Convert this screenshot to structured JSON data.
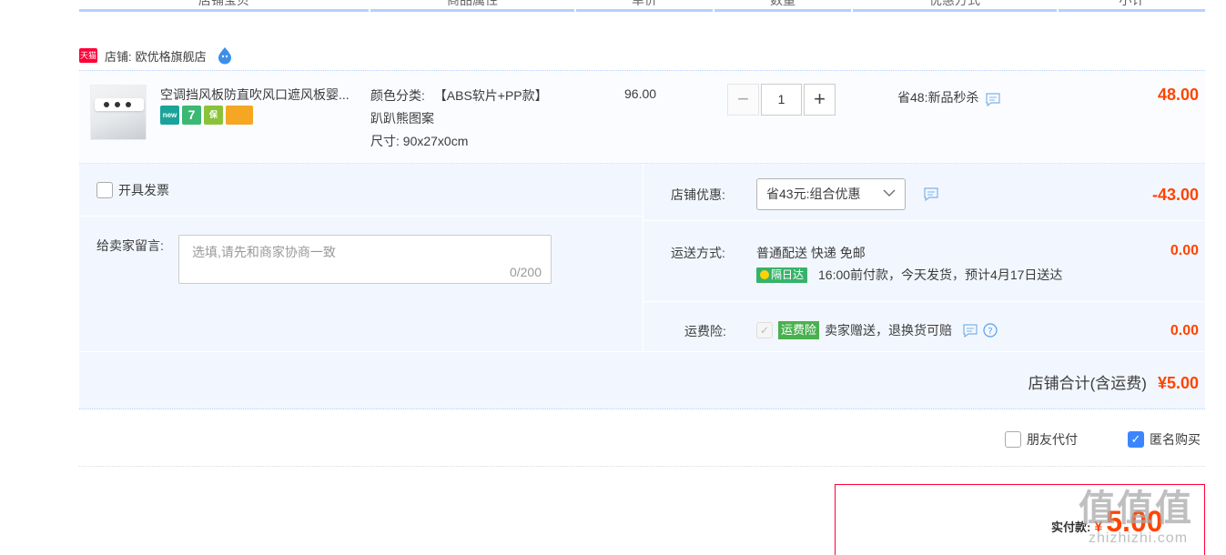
{
  "table_header": {
    "columns": [
      "店铺宝贝",
      "商品属性",
      "单价",
      "数量",
      "优惠方式",
      "小计"
    ]
  },
  "shop": {
    "tmall_badge": "天猫",
    "label": "店铺:",
    "name": "欧优格旗舰店"
  },
  "item": {
    "title": "空调挡风板防直吹风口遮风板婴...",
    "badges": [
      {
        "icon": "new-icon",
        "text": "new",
        "color": "#1aa39a"
      },
      {
        "icon": "seven-day-icon",
        "text": "7",
        "color": "#3bb873"
      },
      {
        "icon": "guarantee-icon",
        "text": "保",
        "color": "#8ac33a"
      },
      {
        "icon": "card-icon",
        "text": "",
        "color": "#f5a623"
      }
    ],
    "prop_color_label": "颜色分类:",
    "prop_color_value": "【ABS软片+PP款】",
    "prop_color_value2": "趴趴熊图案",
    "prop_size": "尺寸: 90x27x0cm",
    "unit_price": "96.00",
    "quantity": "1",
    "minus": "−",
    "plus": "+",
    "promotion": "省48:新品秒杀",
    "subtotal": "48.00"
  },
  "invoice": {
    "label": "开具发票"
  },
  "message": {
    "label": "给卖家留言:",
    "placeholder": "选填,请先和商家协商一致",
    "count": "0/200"
  },
  "shop_discount": {
    "label": "店铺优惠:",
    "selected": "省43元:组合优惠",
    "amount": "-43.00"
  },
  "shipping": {
    "label": "运送方式:",
    "method": "普通配送 快递 免邮",
    "next_day_tag": "隔日达",
    "delivery_note": "16:00前付款，今天发货，预计4月17日送达",
    "amount": "0.00"
  },
  "insurance": {
    "label": "运费险:",
    "tag": "运费险",
    "text": "卖家赠送，退换货可赔",
    "amount": "0.00"
  },
  "shop_total": {
    "label": "店铺合计(含运费)",
    "value": "¥5.00"
  },
  "options": {
    "friend_pay": "朋友代付",
    "anonymous": "匿名购买"
  },
  "payment": {
    "label": "实付款:",
    "currency": "¥",
    "value": "5.00"
  },
  "watermark": {
    "main": "值值值",
    "sub": "zhizhizhi.com"
  },
  "colors": {
    "accent": "#f40",
    "brand_red": "#ff0036",
    "blue": "#3b86ff",
    "header_line": "#b2d1ff"
  }
}
